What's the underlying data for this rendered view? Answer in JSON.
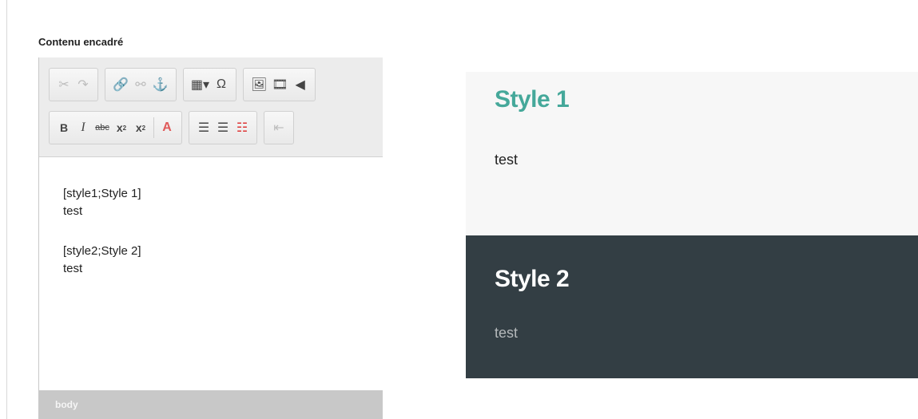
{
  "field": {
    "label": "Contenu encadré"
  },
  "toolbar": {
    "row1": [
      {
        "group": "clipboard",
        "buttons": [
          {
            "name": "cut-icon",
            "glyph": "✂",
            "disabled": true
          },
          {
            "name": "redo-icon",
            "glyph": "↷",
            "disabled": true
          }
        ]
      },
      {
        "group": "links",
        "buttons": [
          {
            "name": "link-icon",
            "glyph": "🔗",
            "disabled": false
          },
          {
            "name": "unlink-icon",
            "glyph": "⚯",
            "disabled": true
          },
          {
            "name": "anchor-icon",
            "glyph": "⚓",
            "disabled": false
          }
        ]
      },
      {
        "group": "insert",
        "buttons": [
          {
            "name": "table-icon",
            "glyph": "▦▾",
            "disabled": false
          },
          {
            "name": "special-char-icon",
            "glyph": "Ω",
            "disabled": false
          }
        ]
      },
      {
        "group": "media",
        "buttons": [
          {
            "name": "image-icon",
            "glyph": "🖼",
            "disabled": false
          },
          {
            "name": "video-icon",
            "glyph": "🎞",
            "disabled": false
          },
          {
            "name": "audio-icon",
            "glyph": "◀",
            "disabled": false
          }
        ]
      }
    ],
    "row2": {
      "bold": "B",
      "italic": "I",
      "strike": "abc",
      "subscript_main": "x",
      "subscript_small": "2",
      "superscript_main": "x",
      "superscript_small": "2",
      "remove_format": "A",
      "ordered_list": "☰",
      "bullet_list": "☰",
      "style_list": "☷",
      "outdent": "⇤"
    }
  },
  "editor": {
    "lines": [
      "[style1;Style 1]",
      "test",
      "[style2;Style 2]",
      "test"
    ],
    "status_path": "body"
  },
  "preview": {
    "style1": {
      "title": "Style 1",
      "body": "test",
      "title_color": "#45a89a",
      "bg": "#f7f7f7"
    },
    "style2": {
      "title": "Style 2",
      "body": "test",
      "title_color": "#ffffff",
      "bg": "#333e44"
    }
  }
}
